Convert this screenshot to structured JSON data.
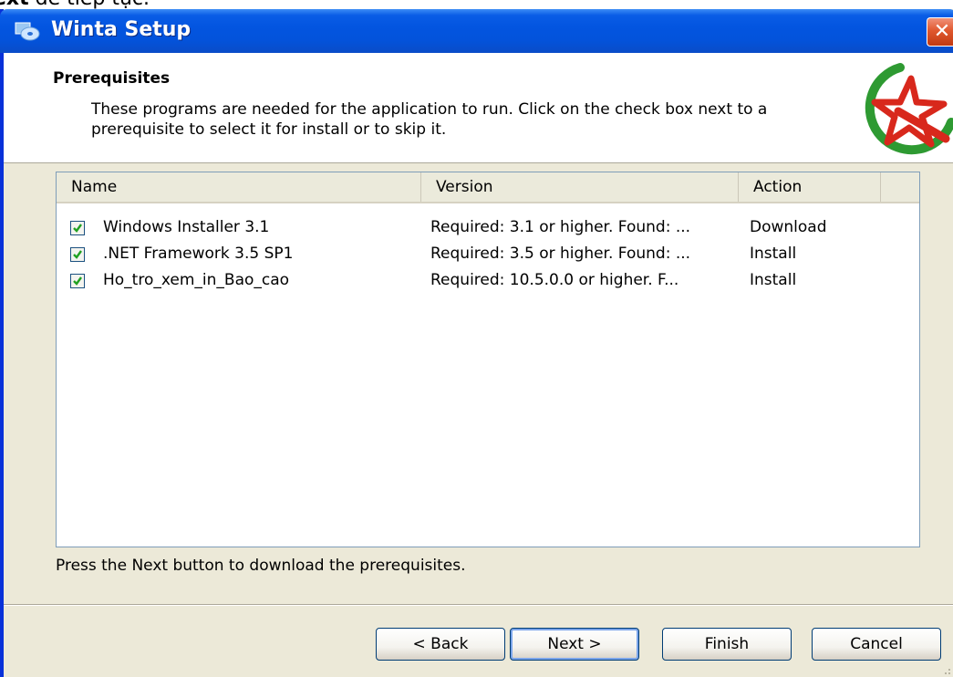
{
  "doc": {
    "prefix": "ext",
    "suffix": " để tiếp tục."
  },
  "window": {
    "title": "Winta Setup"
  },
  "header": {
    "title": "Prerequisites",
    "description": "These programs are needed for the application to run. Click on the check box next to a prerequisite to select it for install or to skip it."
  },
  "list": {
    "columns": [
      "Name",
      "Version",
      "Action"
    ],
    "rows": [
      {
        "checked": true,
        "name": "Windows Installer 3.1",
        "version": "Required: 3.1 or higher. Found: ...",
        "action": "Download"
      },
      {
        "checked": true,
        "name": ".NET Framework 3.5 SP1",
        "version": "Required: 3.5 or higher. Found: ...",
        "action": "Install"
      },
      {
        "checked": true,
        "name": "Ho_tro_xem_in_Bao_cao",
        "version": "Required: 10.5.0.0 or higher. F...",
        "action": "Install"
      }
    ]
  },
  "footer": {
    "message": "Press the Next button to download the prerequisites."
  },
  "buttons": {
    "back": "< Back",
    "next": "Next >",
    "finish": "Finish",
    "cancel": "Cancel"
  },
  "icons": {
    "title": "setup-disc-icon",
    "logo": "winta-star-logo",
    "close": "close-icon",
    "check": "checkmark-icon"
  },
  "colors": {
    "titlebar": "#0355e0",
    "close": "#e0582e",
    "check": "#21a121",
    "logo_green": "#2e9a32",
    "logo_red": "#d8281c"
  }
}
